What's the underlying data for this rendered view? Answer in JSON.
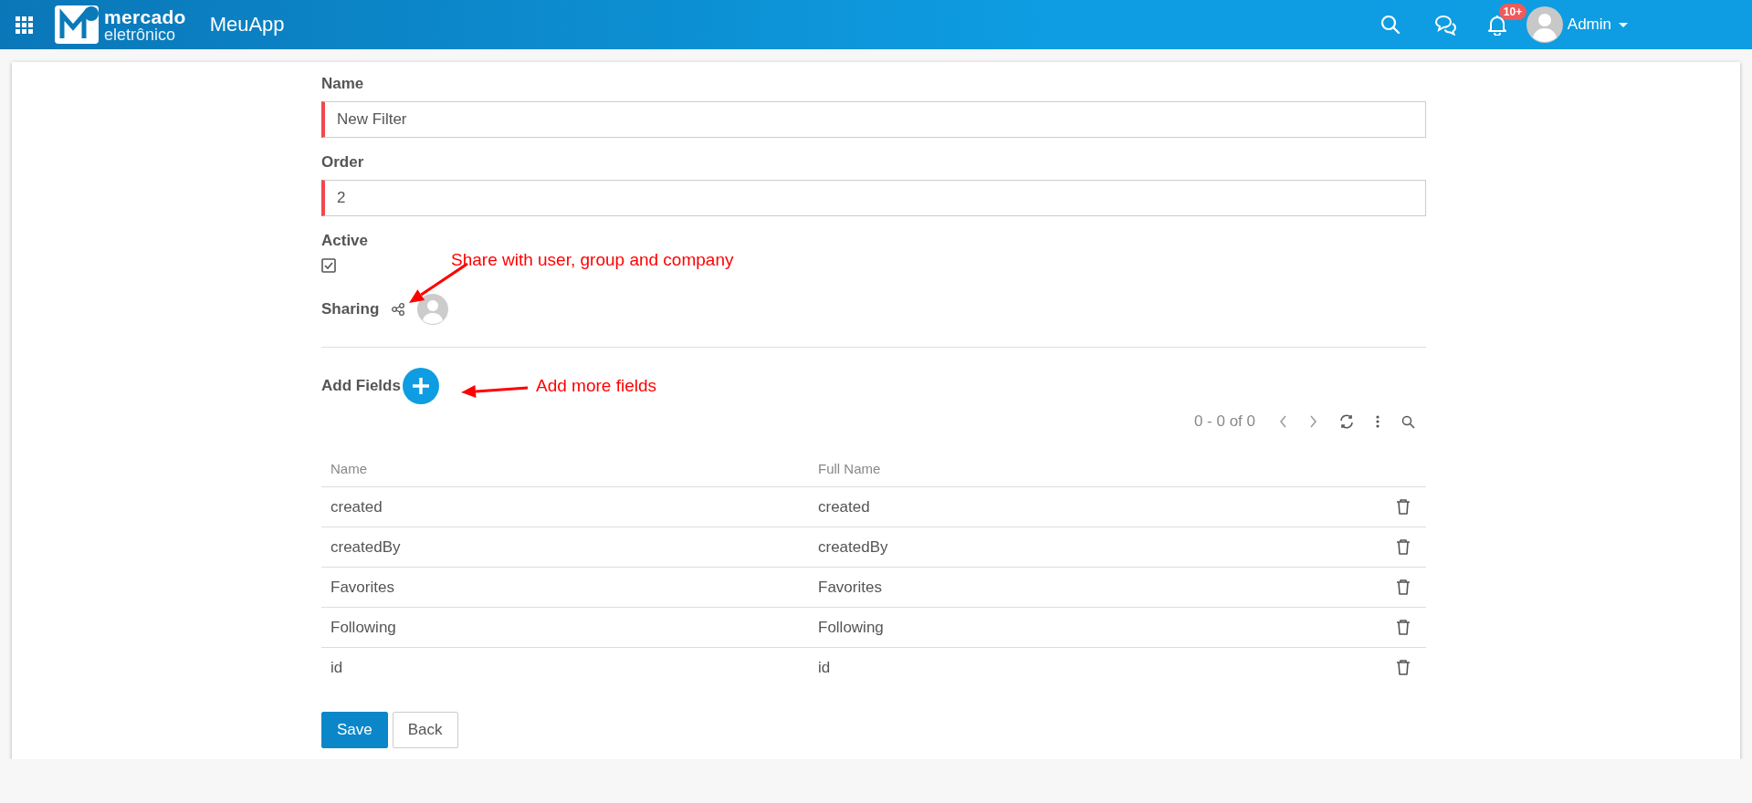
{
  "header": {
    "logo": {
      "line1": "mercado",
      "line2": "eletrônico"
    },
    "app_name": "MeuApp",
    "notification_badge": "10+",
    "user": "Admin"
  },
  "form": {
    "fields": [
      {
        "label": "Name",
        "value": "New Filter",
        "required": true
      },
      {
        "label": "Order",
        "value": "2",
        "required": true
      }
    ],
    "active": {
      "label": "Active",
      "checked": true
    },
    "sharing": {
      "label": "Sharing"
    },
    "add_fields": {
      "label": "Add Fields"
    }
  },
  "annotations": [
    {
      "text": "Share with user, group and company"
    },
    {
      "text": "Add more fields"
    }
  ],
  "table": {
    "pager": "0 - 0 of 0",
    "columns": [
      "Name",
      "Full Name"
    ],
    "rows": [
      {
        "name": "created",
        "full_name": "created"
      },
      {
        "name": "createdBy",
        "full_name": "createdBy"
      },
      {
        "name": "Favorites",
        "full_name": "Favorites"
      },
      {
        "name": "Following",
        "full_name": "Following"
      },
      {
        "name": "id",
        "full_name": "id"
      }
    ]
  },
  "buttons": [
    {
      "label": "Save",
      "kind": "primary"
    },
    {
      "label": "Back",
      "kind": "secondary"
    }
  ]
}
